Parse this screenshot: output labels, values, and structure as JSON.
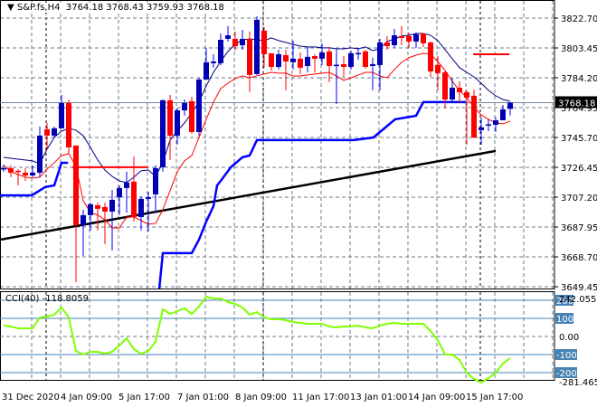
{
  "header": {
    "symbol": "S&P.fs,H4",
    "open": "3764.18",
    "high": "3768.43",
    "low": "3759.93",
    "close": "3768.18"
  },
  "price_axis": {
    "ticks": [
      "3822.70",
      "3803.45",
      "3784.20",
      "3764.95",
      "3745.70",
      "3726.45",
      "3707.20",
      "3687.95",
      "3668.70",
      "3649.45"
    ],
    "current_price": "3768.18"
  },
  "time_axis": {
    "labels": [
      "31 Dec 2020",
      "4 Jan 09:00",
      "5 Jan 17:00",
      "7 Jan 01:00",
      "8 Jan 09:00",
      "11 Jan 17:00",
      "13 Jan 01:00",
      "14 Jan 09:00",
      "15 Jan 17:00"
    ]
  },
  "cci": {
    "label": "CCI(40) -118.8059",
    "max_label": "242.055",
    "min_label": "-281.4652",
    "zero_label": "0.00",
    "levels": [
      "200",
      "100",
      "-100",
      "-200"
    ],
    "values": [
      60,
      55,
      45,
      45,
      45,
      105,
      110,
      120,
      160,
      105,
      -80,
      -100,
      -85,
      -85,
      -95,
      -85,
      -50,
      -10,
      -70,
      -95,
      -80,
      -30,
      150,
      125,
      140,
      155,
      125,
      165,
      220,
      210,
      210,
      190,
      180,
      160,
      120,
      135,
      105,
      95,
      95,
      90,
      80,
      75,
      70,
      70,
      70,
      55,
      50,
      55,
      55,
      60,
      50,
      45,
      60,
      70,
      75,
      70,
      70,
      70,
      70,
      30,
      -20,
      -100,
      -100,
      -130,
      -200,
      -235,
      -255,
      -230,
      -200,
      -150,
      -118.8
    ]
  },
  "colors": {
    "bull": "#0000b4",
    "bear": "#ff0000",
    "upper_line": "#000080",
    "ma_line": "#ff0000",
    "support": "#0000ff",
    "cci": "#7fff00",
    "level": "#4682b4"
  },
  "chart_data": {
    "type": "candlestick",
    "title": "S&P.fs,H4",
    "ylim": [
      3649.45,
      3822.7
    ],
    "candles_ohlc": [
      [
        3725.3,
        3728.2,
        3723.6,
        3725.9
      ],
      [
        3725.9,
        3727.7,
        3720.1,
        3723.0
      ],
      [
        3724.2,
        3725.3,
        3714.8,
        3723.6
      ],
      [
        3723.0,
        3725.9,
        3717.7,
        3721.2
      ],
      [
        3721.2,
        3727.7,
        3720.1,
        3723.0
      ],
      [
        3723.0,
        3752.7,
        3720.1,
        3746.9
      ],
      [
        3751.0,
        3755.1,
        3738.2,
        3746.9
      ],
      [
        3746.9,
        3752.7,
        3745.7,
        3751.6
      ],
      [
        3751.6,
        3773.1,
        3751.6,
        3767.9
      ],
      [
        3767.9,
        3770.2,
        3735.2,
        3739.3
      ],
      [
        3740.5,
        3740.5,
        3652.4,
        3689.2
      ],
      [
        3689.2,
        3699.1,
        3669.3,
        3695.6
      ],
      [
        3695.6,
        3703.7,
        3685.7,
        3702.6
      ],
      [
        3702.0,
        3703.7,
        3685.7,
        3699.7
      ],
      [
        3700.8,
        3703.7,
        3676.9,
        3697.9
      ],
      [
        3697.9,
        3711.9,
        3672.8,
        3705.5
      ],
      [
        3707.2,
        3714.8,
        3695.6,
        3713.1
      ],
      [
        3713.1,
        3723.6,
        3697.3,
        3716.6
      ],
      [
        3717.2,
        3733.5,
        3691.5,
        3694.4
      ],
      [
        3694.4,
        3707.8,
        3685.7,
        3706.1
      ],
      [
        3706.1,
        3710.7,
        3685.1,
        3707.2
      ],
      [
        3709.0,
        3727.7,
        3697.3,
        3725.9
      ],
      [
        3726.5,
        3770.2,
        3723.6,
        3769.7
      ],
      [
        3769.7,
        3773.1,
        3731.2,
        3746.9
      ],
      [
        3746.9,
        3764.4,
        3741.1,
        3763.2
      ],
      [
        3763.2,
        3770.2,
        3759.7,
        3767.9
      ],
      [
        3769.1,
        3772.0,
        3748.1,
        3749.2
      ],
      [
        3749.2,
        3784.2,
        3746.9,
        3783.1
      ],
      [
        3783.1,
        3803.5,
        3783.1,
        3794.2
      ],
      [
        3793.6,
        3799.4,
        3790.7,
        3794.7
      ],
      [
        3793.6,
        3812.8,
        3792.4,
        3808.7
      ],
      [
        3809.3,
        3817.5,
        3807.6,
        3811.6
      ],
      [
        3809.3,
        3814.0,
        3801.7,
        3804.6
      ],
      [
        3805.2,
        3815.1,
        3802.3,
        3809.3
      ],
      [
        3809.3,
        3814.0,
        3774.9,
        3786.0
      ],
      [
        3786.6,
        3823.9,
        3786.0,
        3821.6
      ],
      [
        3814.6,
        3816.9,
        3790.7,
        3799.4
      ],
      [
        3800.0,
        3800.0,
        3788.9,
        3791.2
      ],
      [
        3791.2,
        3802.3,
        3789.5,
        3799.4
      ],
      [
        3798.8,
        3802.3,
        3776.1,
        3794.7
      ],
      [
        3794.2,
        3808.2,
        3789.5,
        3796.5
      ],
      [
        3796.5,
        3800.6,
        3786.6,
        3790.7
      ],
      [
        3791.8,
        3804.1,
        3787.7,
        3797.7
      ],
      [
        3798.2,
        3799.4,
        3787.7,
        3796.5
      ],
      [
        3796.5,
        3806.4,
        3792.4,
        3800.6
      ],
      [
        3801.2,
        3804.1,
        3781.3,
        3791.8
      ],
      [
        3792.4,
        3802.3,
        3767.3,
        3792.6
      ],
      [
        3793.0,
        3798.2,
        3784.8,
        3791.2
      ],
      [
        3791.2,
        3801.7,
        3789.5,
        3800.0
      ],
      [
        3800.0,
        3803.5,
        3795.9,
        3800.2
      ],
      [
        3801.2,
        3802.3,
        3790.1,
        3791.2
      ],
      [
        3791.8,
        3797.1,
        3776.1,
        3793.0
      ],
      [
        3792.4,
        3809.3,
        3776.1,
        3807.0
      ],
      [
        3807.0,
        3811.1,
        3802.3,
        3804.6
      ],
      [
        3805.2,
        3815.7,
        3803.5,
        3811.6
      ],
      [
        3811.1,
        3817.5,
        3805.2,
        3809.9
      ],
      [
        3811.1,
        3813.4,
        3803.5,
        3807.6
      ],
      [
        3807.6,
        3813.4,
        3803.5,
        3812.2
      ],
      [
        3812.8,
        3812.8,
        3804.1,
        3806.4
      ],
      [
        3807.0,
        3807.6,
        3784.8,
        3788.3
      ],
      [
        3792.4,
        3798.2,
        3776.1,
        3787.2
      ],
      [
        3787.7,
        3788.3,
        3764.4,
        3770.2
      ],
      [
        3770.2,
        3784.2,
        3769.1,
        3777.8
      ],
      [
        3777.8,
        3781.9,
        3767.9,
        3774.9
      ],
      [
        3774.9,
        3776.1,
        3741.1,
        3771.4
      ],
      [
        3772.6,
        3776.7,
        3745.2,
        3745.7
      ],
      [
        3750.4,
        3758.6,
        3741.1,
        3752.2
      ],
      [
        3753.9,
        3757.4,
        3749.8,
        3754.2
      ],
      [
        3753.9,
        3758.6,
        3749.2,
        3756.8
      ],
      [
        3756.8,
        3766.7,
        3756.8,
        3763.8
      ],
      [
        3764.18,
        3768.43,
        3759.93,
        3768.18
      ]
    ],
    "upper_line": [
      3732.9,
      3732.3,
      3731.7,
      3731.2,
      3730.6,
      3728.8,
      3738.2,
      3745.7,
      3749.8,
      3751.6,
      3750.4,
      3746.9,
      3739.3,
      3731.2,
      3724.7,
      3720.6,
      3717.7,
      3716.6,
      3720.1,
      3724.2,
      3724.7,
      3720.6,
      3729.4,
      3744.0,
      3749.8,
      3755.1,
      3761.5,
      3768.5,
      3779.0,
      3787.7,
      3794.7,
      3801.2,
      3805.8,
      3808.7,
      3809.3,
      3808.7,
      3808.2,
      3809.9,
      3808.2,
      3807.0,
      3805.8,
      3804.6,
      3804.1,
      3804.1,
      3803.5,
      3803.5,
      3802.9,
      3802.9,
      3803.5,
      3802.9,
      3804.1,
      3801.7,
      3802.9,
      3807.6,
      3809.3,
      3811.1,
      3811.6,
      3812.8,
      3812.8,
      3811.6,
      3808.2,
      3802.3,
      3796.5,
      3790.7,
      3787.7,
      3784.8,
      3780.7,
      3776.1,
      3772.6,
      3770.2,
      3769.1
    ],
    "ma_line": [
      3727.7,
      3723.6,
      3721.8,
      3720.1,
      3719.5,
      3720.1,
      3725.3,
      3729.4,
      3734.1,
      3735.2,
      3727.1,
      3704.9,
      3697.3,
      3695.6,
      3692.7,
      3687.4,
      3687.4,
      3694.4,
      3694.4,
      3692.1,
      3689.7,
      3690.3,
      3699.1,
      3711.3,
      3723.6,
      3730.6,
      3734.1,
      3745.7,
      3757.4,
      3768.5,
      3777.2,
      3780.7,
      3783.7,
      3785.4,
      3784.2,
      3785.4,
      3786.6,
      3787.7,
      3787.2,
      3787.2,
      3785.4,
      3785.4,
      3786.0,
      3786.6,
      3787.2,
      3787.7,
      3785.4,
      3782.5,
      3784.2,
      3786.0,
      3787.7,
      3787.7,
      3785.4,
      3784.2,
      3789.5,
      3794.2,
      3797.1,
      3798.8,
      3800.0,
      3799.4,
      3794.7,
      3788.9,
      3781.9,
      3776.1,
      3771.4,
      3765.2,
      3760.3,
      3757.4,
      3755.1,
      3754.5,
      3756.3
    ],
    "support_segments": [
      [
        [
          -0.5,
          3708.4
        ],
        [
          3.9,
          3708.4
        ],
        [
          5.75,
          3713.7
        ],
        [
          7,
          3714.8
        ],
        [
          8,
          3729.4
        ],
        [
          8.9,
          3729.4
        ]
      ],
      [
        [
          21.5,
          3647.7
        ],
        [
          22,
          3671.1
        ],
        [
          26,
          3671.1
        ],
        [
          27,
          3679.8
        ],
        [
          28,
          3691.5
        ],
        [
          29,
          3701.4
        ],
        [
          29.5,
          3714.8
        ],
        [
          30,
          3717.7
        ],
        [
          31.4,
          3726.5
        ],
        [
          33,
          3732.9
        ],
        [
          34,
          3734.1
        ],
        [
          35,
          3744.0
        ],
        [
          48.4,
          3744.0
        ],
        [
          51.1,
          3745.7
        ],
        [
          52.9,
          3752.7
        ],
        [
          54.1,
          3757.4
        ],
        [
          57,
          3759.7
        ],
        [
          58,
          3768.5
        ],
        [
          63.9,
          3768.5
        ]
      ]
    ],
    "trendline": [
      [
        -0.5,
        3679.8
      ],
      [
        68,
        3737.0
      ]
    ],
    "horizontal_levels": [
      {
        "from": 9.5,
        "to": 19.9,
        "price": 3726.5
      },
      {
        "from": 64.9,
        "to": 69.9,
        "price": 3799.4
      }
    ]
  }
}
